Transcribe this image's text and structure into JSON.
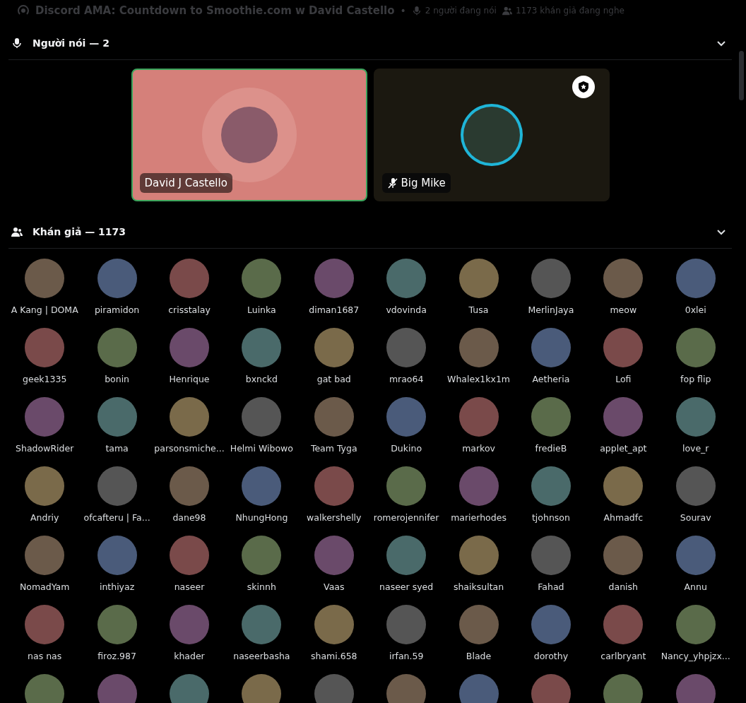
{
  "header": {
    "title": "Discord AMA: Countdown to Smoothie.com w David Castello",
    "separator": "•",
    "speaking_count": "2 người đang nói",
    "listening_count": "1173 khán giả đang nghe"
  },
  "speakers_section": {
    "title": "Người nói — 2",
    "expanded": true,
    "speakers": [
      {
        "name": "David J Castello",
        "speaking": true,
        "muted": false,
        "moderator": false
      },
      {
        "name": "Big Mike",
        "speaking": false,
        "muted": true,
        "moderator": true
      }
    ]
  },
  "audience_section": {
    "title": "Khán giả — 1173",
    "expanded": true,
    "members": [
      "A Kang | DOMA",
      "piramidon",
      "crisstalay",
      "Luinka",
      "diman1687",
      "vdovinda",
      "Tusa",
      "MerlinJaya",
      "meow",
      "0xlei",
      "geek1335",
      "bonin",
      "Henrique",
      "bxnckd",
      "gat bad",
      "mrao64",
      "Whalex1kx1m",
      "Aetheria",
      "Lofi",
      "fop flip",
      "ShadowRider",
      "tama",
      "parsonsmiche...",
      "Helmi Wibowo",
      "Team Tyga",
      "Dukino",
      "markov",
      "fredieB",
      "applet_apt",
      "love_r",
      "Andriy",
      "ofcafteru | Fa...",
      "dane98",
      "NhungHong",
      "walkershelly",
      "romerojennifer",
      "marierhodes",
      "tjohnson",
      "Ahmadfc",
      "Sourav",
      "NomadYam",
      "inthiyaz",
      "naseer",
      "skinnh",
      "Vaas",
      "naseer syed",
      "shaiksultan",
      "Fahad",
      "danish",
      "Annu",
      "nas nas",
      "firoz.987",
      "khader",
      "naseerbasha",
      "shami.658",
      "irfan.59",
      "Blade",
      "dorothy",
      "carlbryant",
      "Nancy_yhpjzx..."
    ]
  }
}
